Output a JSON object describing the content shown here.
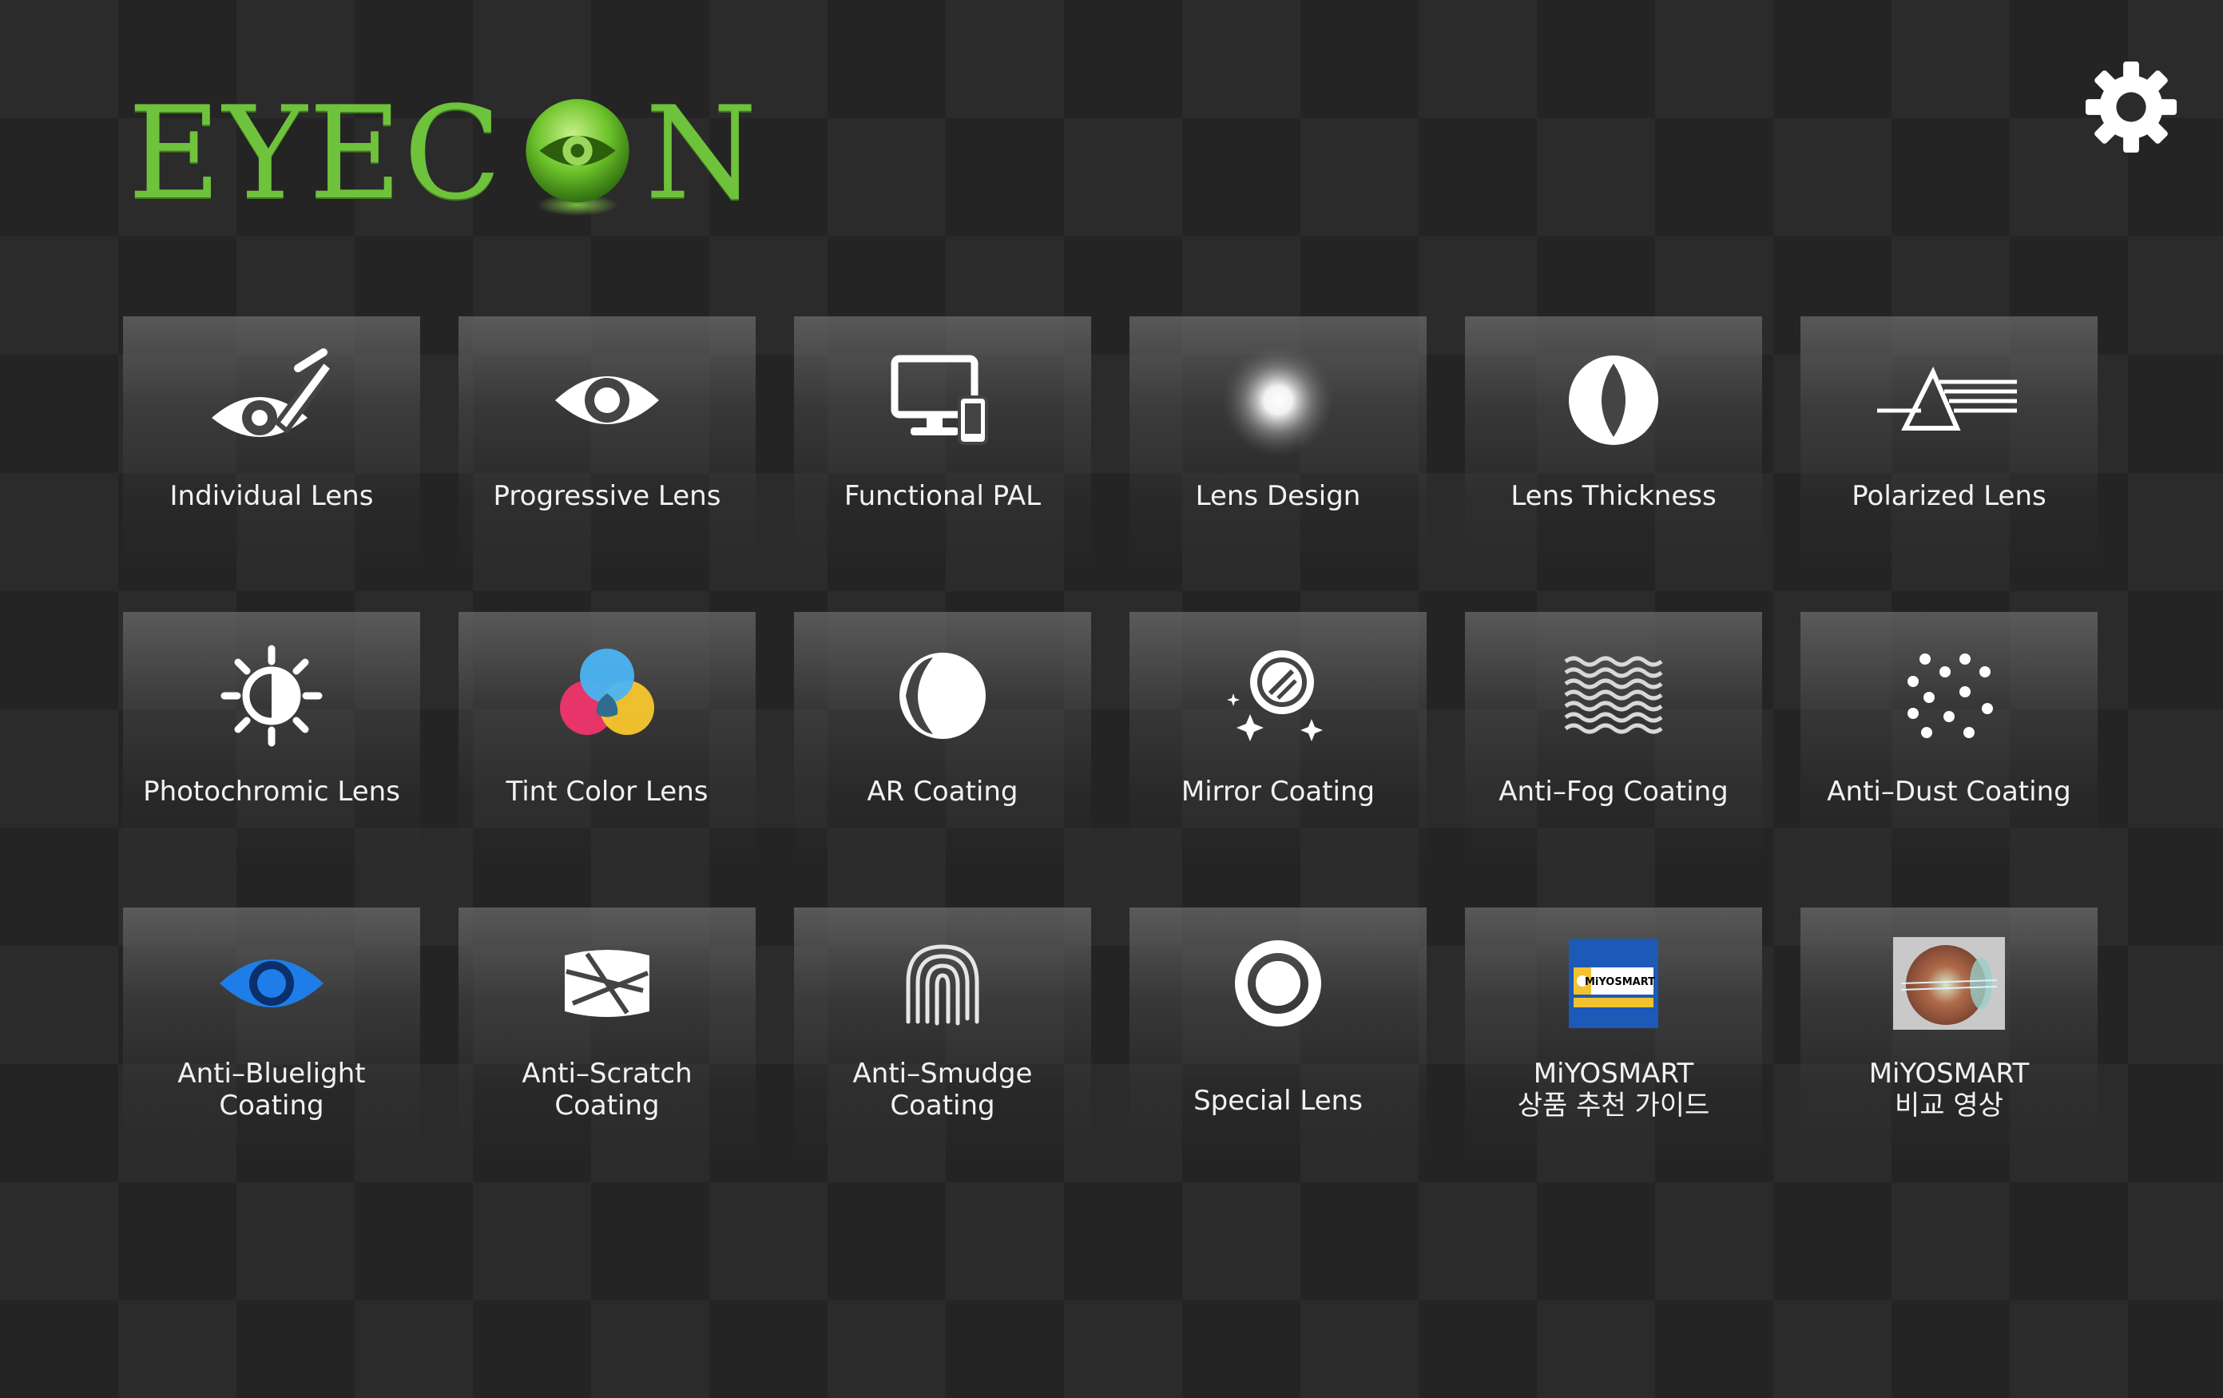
{
  "app": {
    "logo_text_left": "EYEC",
    "logo_text_right": "N",
    "accent_color": "#6fc23c"
  },
  "header": {
    "settings_icon": "gear-icon"
  },
  "tiles": [
    {
      "line1": "Individual Lens",
      "line2": "",
      "icon": "eye-pen-icon"
    },
    {
      "line1": "Progressive Lens",
      "line2": "",
      "icon": "eye-icon"
    },
    {
      "line1": "Functional PAL",
      "line2": "",
      "icon": "devices-icon"
    },
    {
      "line1": "Lens Design",
      "line2": "",
      "icon": "lens-glow-icon"
    },
    {
      "line1": "Lens Thickness",
      "line2": "",
      "icon": "lens-thickness-icon"
    },
    {
      "line1": "Polarized Lens",
      "line2": "",
      "icon": "polarized-icon"
    },
    {
      "line1": "Photochromic Lens",
      "line2": "",
      "icon": "sun-icon"
    },
    {
      "line1": "Tint Color Lens",
      "line2": "",
      "icon": "color-circles-icon"
    },
    {
      "line1": "AR Coating",
      "line2": "",
      "icon": "crescent-icon"
    },
    {
      "line1": "Mirror Coating",
      "line2": "",
      "icon": "mirror-sparkle-icon"
    },
    {
      "line1": "Anti–Fog Coating",
      "line2": "",
      "icon": "waves-icon"
    },
    {
      "line1": "Anti–Dust Coating",
      "line2": "",
      "icon": "dots-icon"
    },
    {
      "line1": "Anti–Bluelight",
      "line2": "Coating",
      "icon": "blue-eye-icon"
    },
    {
      "line1": "Anti–Scratch",
      "line2": "Coating",
      "icon": "scratch-icon"
    },
    {
      "line1": "Anti–Smudge",
      "line2": "Coating",
      "icon": "fingerprint-icon"
    },
    {
      "line1": "Special Lens",
      "line2": "",
      "icon": "ring-icon"
    },
    {
      "line1": "MiYOSMART",
      "line2": "상품 추천 가이드",
      "icon": "miyosmart-box-icon",
      "thumb_text": "MiYOSMART"
    },
    {
      "line1": "MiYOSMART",
      "line2": "비교 영상",
      "icon": "eyeball-video-thumbnail"
    }
  ]
}
